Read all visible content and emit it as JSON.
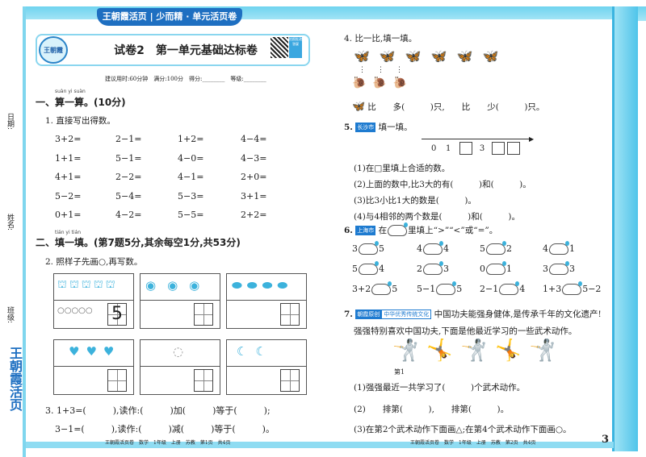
{
  "header": {
    "banner": "王朝霞活页 | 少而精 · 单元活页卷",
    "logo": "王朝霞",
    "title": "试卷2　第一单元基础达标卷",
    "qr_label": "拍照批改答疑",
    "meta": "建议用时:60分钟　满分:100分　得分:________　等级:________"
  },
  "sidebar": {
    "date": "日期:",
    "name": "姓名:",
    "class": "班级:",
    "brand": "王朝霞活页"
  },
  "section1": {
    "pinyin": "suàn yi suàn",
    "title": "一、算一算。(10分)",
    "q1": "1. 直接写出得数。",
    "equations": [
      [
        "3+2=",
        "2−1=",
        "1+2=",
        "4−4="
      ],
      [
        "1+1=",
        "5−1=",
        "4−0=",
        "4−3="
      ],
      [
        "4+1=",
        "2−2=",
        "4−1=",
        "2+0="
      ],
      [
        "5−2=",
        "5−4=",
        "5−3=",
        "3+1="
      ],
      [
        "0+1=",
        "4−2=",
        "5−5=",
        "2+2="
      ]
    ]
  },
  "section2": {
    "pinyin": "tián yi tián",
    "title": "二、填一填。(第7题5分,其余每空1分,共53分)",
    "q2": "2. 照样子先画○,再写数。",
    "example_circles": "○○○○○",
    "example_number": "5",
    "q3_line1": "3. 1+3=(　　　),读作:(　　　)加(　　　)等于(　　　);",
    "q3_line2": "3−1=(　　　),读作:(　　　)减(　　　)等于(　　　)。"
  },
  "q4": {
    "title": "4. 比一比,填一填。",
    "line": "比　　多(　　　)只,　　比　　少(　　　)只。"
  },
  "q5": {
    "num": "5.",
    "tag": "长沙市",
    "title": "填一填。",
    "ticks": [
      "0",
      "1",
      "",
      "3",
      "",
      ""
    ],
    "items": [
      "(1)在□里填上合适的数。",
      "(2)上面的数中,比3大的有(　　　)和(　　　)。",
      "(3)比3小比1大的数是(　　　)。",
      "(4)与4相邻的两个数是(　　　)和(　　　)。"
    ]
  },
  "q6": {
    "num": "6.",
    "tag": "上海市",
    "title_pre": "在",
    "title_post": "里填上“>”“<”或“=”。",
    "rows": [
      [
        [
          "3",
          "5"
        ],
        [
          "4",
          "4"
        ],
        [
          "5",
          "2"
        ],
        [
          "4",
          "1"
        ]
      ],
      [
        [
          "5",
          "4"
        ],
        [
          "2",
          "3"
        ],
        [
          "0",
          "1"
        ],
        [
          "3",
          "3"
        ]
      ],
      [
        [
          "3+2",
          "5"
        ],
        [
          "5−1",
          "5"
        ],
        [
          "2−1",
          "4"
        ],
        [
          "1+3",
          "5−2"
        ]
      ]
    ]
  },
  "q7": {
    "num": "7.",
    "tag1": "朝霞原创",
    "tag2": "中华优秀传统文化",
    "line1": "中国功夫能强身健体,是传承千年的文化遗产!",
    "line2": "强强特别喜欢中国功夫,下面是他最近学习的一些武术动作。",
    "first_label": "第1",
    "items": [
      "(1)强强最近一共学习了(　　　)个武术动作。",
      "(2)　　排第(　　　),　　排第(　　　)。",
      "(3)在第2个武术动作下面画△;在第4个武术动作下面画○。"
    ]
  },
  "footer": {
    "left": "王朝霞活页卷　数学　1年级　上册　苏教　第1页　共4页",
    "right": "王朝霞活页卷　数学　1年级　上册　苏教　第2页　共4页",
    "page_number": "3"
  }
}
